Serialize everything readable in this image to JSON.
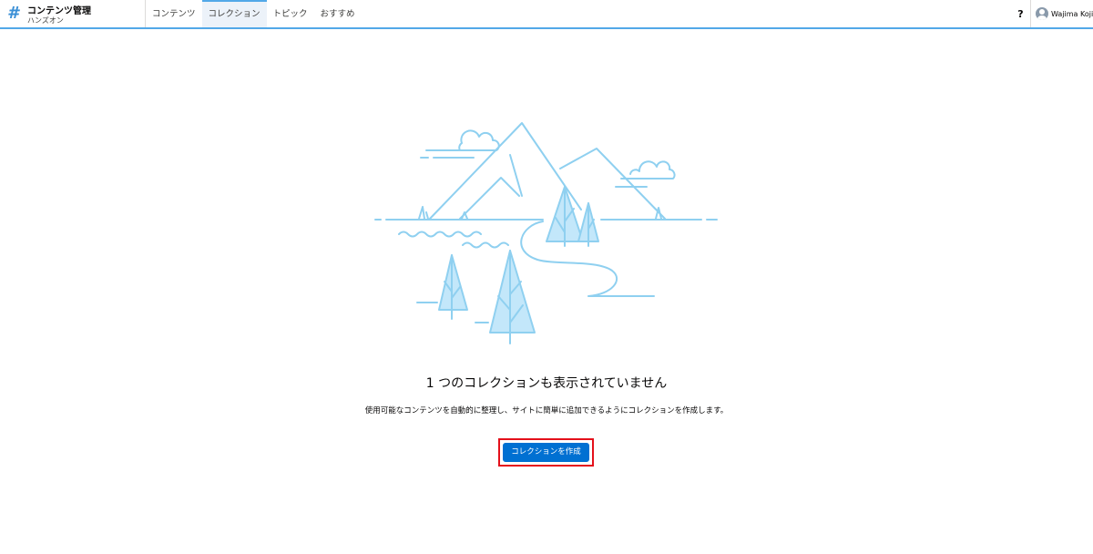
{
  "app": {
    "title": "コンテンツ管理",
    "subtitle": "ハンズオン",
    "icon": "hash-icon"
  },
  "nav": {
    "tabs": [
      {
        "label": "コンテンツ",
        "active": false
      },
      {
        "label": "コレクション",
        "active": true
      },
      {
        "label": "トピック",
        "active": false
      },
      {
        "label": "おすすめ",
        "active": false
      }
    ]
  },
  "header_right": {
    "help_label": "?",
    "user_name": "Wajima Koji"
  },
  "empty_state": {
    "heading": "1 つのコレクションも表示されていません",
    "description": "使用可能なコンテンツを自動的に整理し、サイトに簡単に追加できるようにコレクションを作成します。",
    "button_label": "コレクションを作成"
  },
  "colors": {
    "accent": "#52a8e8",
    "button": "#0070d2",
    "highlight": "#e4101b",
    "illustration_stroke": "#8fd0f0",
    "illustration_fill": "#c3e7fa"
  }
}
